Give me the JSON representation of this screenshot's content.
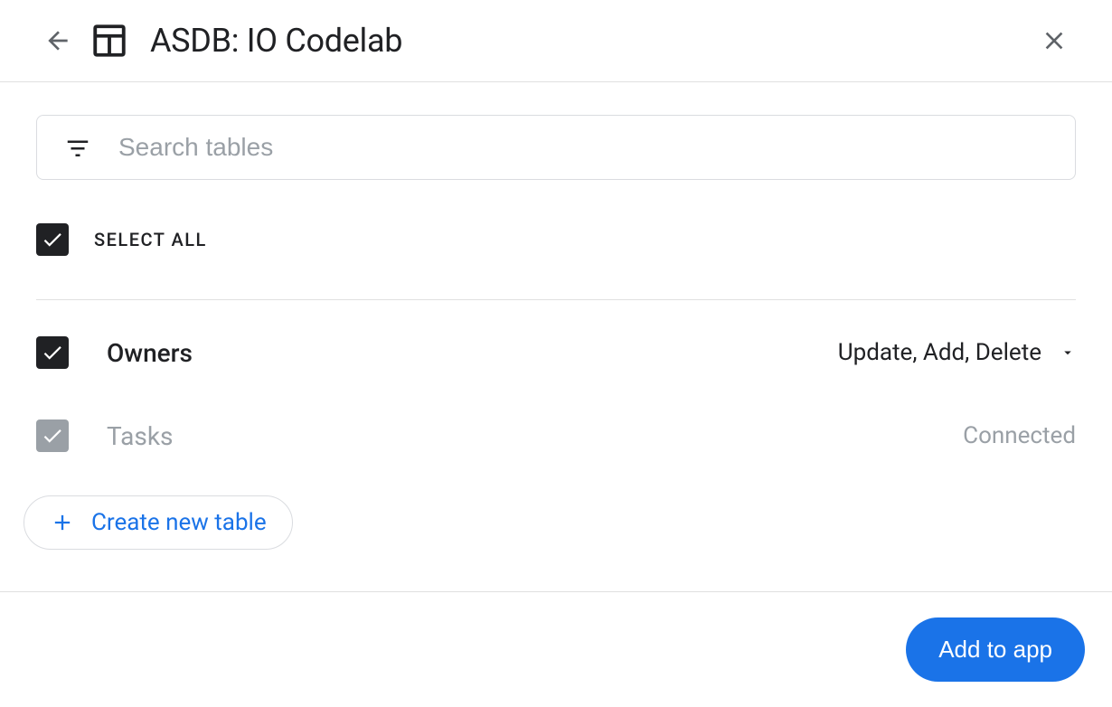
{
  "header": {
    "title": "ASDB: IO Codelab"
  },
  "search": {
    "placeholder": "Search tables"
  },
  "selectAll": {
    "label": "SELECT ALL",
    "checked": true
  },
  "tables": [
    {
      "name": "Owners",
      "checked": true,
      "disabled": false,
      "permissions": "Update, Add, Delete",
      "status": ""
    },
    {
      "name": "Tasks",
      "checked": true,
      "disabled": true,
      "permissions": "",
      "status": "Connected"
    }
  ],
  "actions": {
    "createTable": "Create new table",
    "addToApp": "Add to app"
  }
}
